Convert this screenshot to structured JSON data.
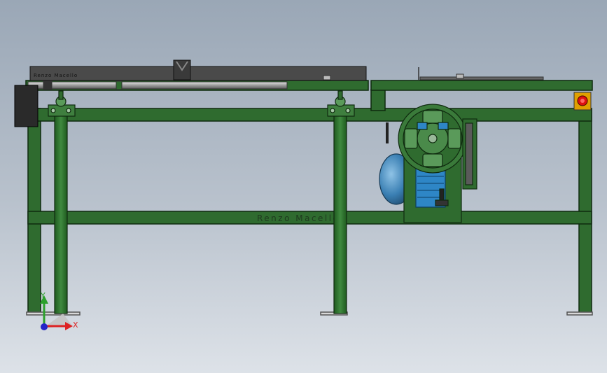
{
  "model": {
    "name_plate_label": "Renzo Macello",
    "frame_engraving": "Renzo Macello"
  },
  "triad": {
    "x_label": "X",
    "y_label": "Y"
  },
  "colors": {
    "frame_green": "#2f6b2f",
    "frame_edge": "#0f2a0f",
    "motor_blue": "#3a7fb3",
    "stop_button_red": "#d11",
    "plate_gray": "#4a4a4a",
    "background_top": "#9aa7b6",
    "background_bottom": "#dde2e8"
  }
}
